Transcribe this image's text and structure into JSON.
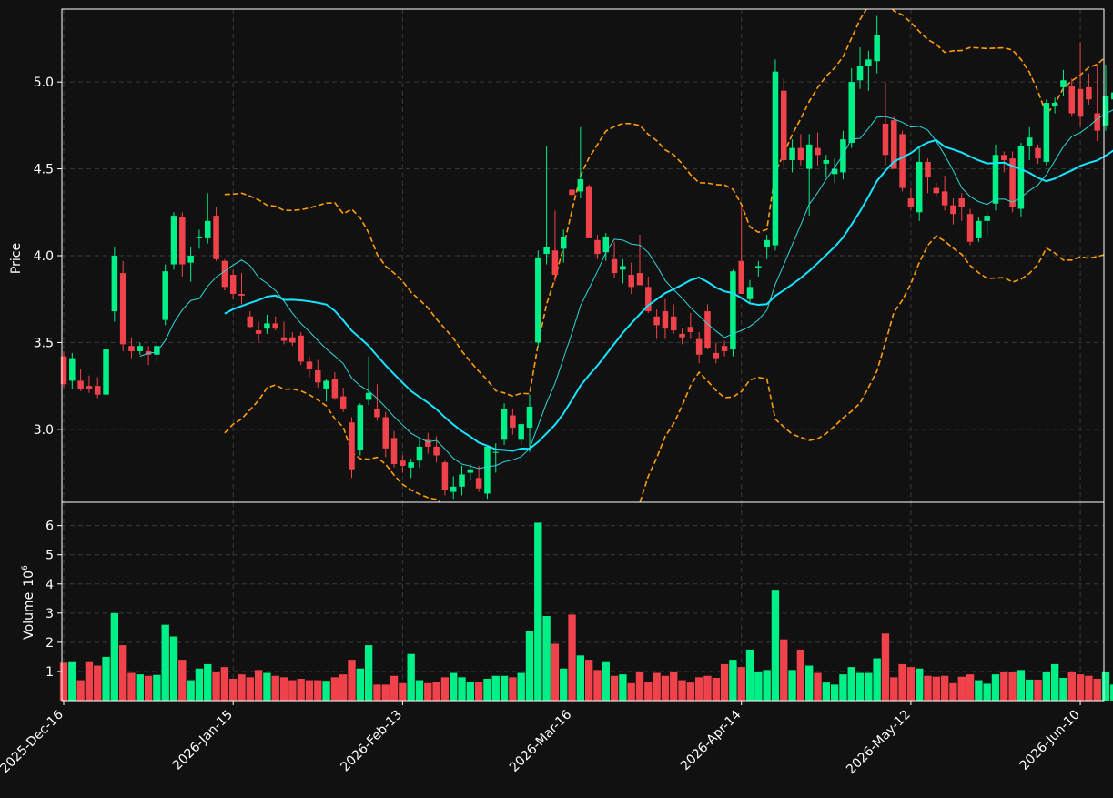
{
  "chart_data": {
    "type": "candlestick",
    "title": "",
    "colors": {
      "background": "#111111",
      "up": "#00f088",
      "down": "#f0424a",
      "ma_fast": "#2fd7d7",
      "ma_slow": "#18e4ff",
      "bands": "#ff9d0a",
      "grid": "#3a3a3a",
      "text": "#ffffff"
    },
    "price_panel": {
      "ylabel": "Price",
      "ylim": [
        2.58,
        5.42
      ],
      "yticks": [
        {
          "value": 3.0,
          "label": "3.0"
        },
        {
          "value": 3.5,
          "label": "3.5"
        },
        {
          "value": 4.0,
          "label": "4.0"
        },
        {
          "value": 4.5,
          "label": "4.5"
        },
        {
          "value": 5.0,
          "label": "5.0"
        }
      ]
    },
    "volume_panel": {
      "ylabel": "Volume",
      "ylabel_exp": "10",
      "ylabel_exp_power": "6",
      "ylim": [
        0,
        6.8
      ],
      "yticks": [
        {
          "value": 1,
          "label": "1"
        },
        {
          "value": 2,
          "label": "2"
        },
        {
          "value": 3,
          "label": "3"
        },
        {
          "value": 4,
          "label": "4"
        },
        {
          "value": 5,
          "label": "5"
        },
        {
          "value": 6,
          "label": "6"
        }
      ]
    },
    "x_axis": {
      "n": 124,
      "ticks": [
        {
          "index": 0,
          "label": "2025-Dec-16"
        },
        {
          "index": 20,
          "label": "2026-Jan-15"
        },
        {
          "index": 40,
          "label": "2026-Feb-13"
        },
        {
          "index": 60,
          "label": "2026-Mar-16"
        },
        {
          "index": 80,
          "label": "2026-Apr-14"
        },
        {
          "index": 100,
          "label": "2026-May-12"
        },
        {
          "index": 120,
          "label": "2026-Jun-10"
        }
      ]
    },
    "ohlc": [
      [
        3.42,
        3.45,
        3.24,
        3.26
      ],
      [
        3.28,
        3.44,
        3.23,
        3.41
      ],
      [
        3.28,
        3.35,
        3.22,
        3.23
      ],
      [
        3.25,
        3.31,
        3.21,
        3.23
      ],
      [
        3.25,
        3.3,
        3.18,
        3.2
      ],
      [
        3.2,
        3.49,
        3.19,
        3.46
      ],
      [
        3.68,
        4.05,
        3.62,
        4.0
      ],
      [
        3.9,
        3.97,
        3.45,
        3.49
      ],
      [
        3.48,
        3.53,
        3.41,
        3.45
      ],
      [
        3.45,
        3.5,
        3.43,
        3.48
      ],
      [
        3.45,
        3.48,
        3.37,
        3.43
      ],
      [
        3.43,
        3.5,
        3.38,
        3.48
      ],
      [
        3.63,
        3.95,
        3.6,
        3.91
      ],
      [
        3.95,
        4.25,
        3.92,
        4.23
      ],
      [
        4.22,
        4.25,
        3.88,
        3.95
      ],
      [
        3.96,
        4.05,
        3.85,
        4.0
      ],
      [
        4.1,
        4.15,
        4.04,
        4.11
      ],
      [
        4.1,
        4.36,
        4.07,
        4.2
      ],
      [
        4.23,
        4.28,
        3.97,
        3.98
      ],
      [
        3.97,
        3.98,
        3.8,
        3.82
      ],
      [
        3.89,
        3.92,
        3.75,
        3.78
      ],
      [
        3.78,
        3.9,
        3.72,
        3.77
      ],
      [
        3.65,
        3.68,
        3.58,
        3.59
      ],
      [
        3.57,
        3.62,
        3.5,
        3.55
      ],
      [
        3.58,
        3.66,
        3.55,
        3.61
      ],
      [
        3.61,
        3.65,
        3.57,
        3.58
      ],
      [
        3.53,
        3.62,
        3.49,
        3.51
      ],
      [
        3.53,
        3.56,
        3.48,
        3.5
      ],
      [
        3.54,
        3.56,
        3.37,
        3.39
      ],
      [
        3.39,
        3.42,
        3.3,
        3.35
      ],
      [
        3.34,
        3.4,
        3.24,
        3.27
      ],
      [
        3.23,
        3.29,
        3.16,
        3.28
      ],
      [
        3.29,
        3.33,
        3.17,
        3.18
      ],
      [
        3.19,
        3.24,
        3.1,
        3.12
      ],
      [
        3.04,
        3.07,
        2.72,
        2.77
      ],
      [
        2.88,
        3.15,
        2.85,
        3.14
      ],
      [
        3.17,
        3.42,
        3.14,
        3.21
      ],
      [
        3.12,
        3.26,
        3.05,
        3.07
      ],
      [
        3.07,
        3.1,
        2.84,
        2.89
      ],
      [
        2.95,
        2.99,
        2.78,
        2.8
      ],
      [
        2.82,
        2.85,
        2.75,
        2.79
      ],
      [
        2.78,
        2.83,
        2.72,
        2.81
      ],
      [
        2.82,
        2.95,
        2.78,
        2.9
      ],
      [
        2.94,
        2.98,
        2.86,
        2.9
      ],
      [
        2.9,
        2.96,
        2.81,
        2.85
      ],
      [
        2.81,
        2.82,
        2.62,
        2.65
      ],
      [
        2.64,
        2.73,
        2.6,
        2.67
      ],
      [
        2.67,
        2.79,
        2.62,
        2.74
      ],
      [
        2.75,
        2.8,
        2.71,
        2.77
      ],
      [
        2.72,
        2.79,
        2.64,
        2.66
      ],
      [
        2.63,
        2.9,
        2.6,
        2.9
      ],
      [
        2.87,
        2.92,
        2.75,
        2.87
      ],
      [
        2.94,
        3.15,
        2.91,
        3.12
      ],
      [
        3.08,
        3.12,
        2.97,
        3.01
      ],
      [
        2.94,
        3.04,
        2.91,
        3.03
      ],
      [
        3.01,
        3.2,
        2.87,
        3.13
      ],
      [
        3.5,
        4.03,
        3.47,
        3.99
      ],
      [
        4.01,
        4.63,
        3.95,
        4.05
      ],
      [
        4.03,
        4.26,
        3.85,
        3.89
      ],
      [
        4.04,
        4.15,
        3.96,
        4.11
      ],
      [
        4.38,
        4.6,
        4.32,
        4.35
      ],
      [
        4.37,
        4.74,
        4.33,
        4.44
      ],
      [
        4.4,
        4.41,
        4.12,
        4.1
      ],
      [
        4.09,
        4.12,
        3.98,
        4.01
      ],
      [
        4.02,
        4.13,
        3.97,
        4.11
      ],
      [
        3.98,
        4.08,
        3.87,
        3.9
      ],
      [
        3.92,
        3.98,
        3.84,
        3.94
      ],
      [
        3.89,
        3.96,
        3.78,
        3.82
      ],
      [
        3.9,
        4.12,
        3.86,
        3.83
      ],
      [
        3.82,
        3.88,
        3.67,
        3.68
      ],
      [
        3.65,
        3.69,
        3.52,
        3.6
      ],
      [
        3.68,
        3.75,
        3.52,
        3.58
      ],
      [
        3.65,
        3.72,
        3.55,
        3.57
      ],
      [
        3.55,
        3.58,
        3.49,
        3.53
      ],
      [
        3.59,
        3.67,
        3.52,
        3.56
      ],
      [
        3.52,
        3.56,
        3.38,
        3.43
      ],
      [
        3.68,
        3.72,
        3.46,
        3.47
      ],
      [
        3.44,
        3.5,
        3.38,
        3.41
      ],
      [
        3.48,
        3.51,
        3.42,
        3.45
      ],
      [
        3.46,
        3.92,
        3.42,
        3.91
      ],
      [
        3.97,
        4.28,
        3.88,
        3.78
      ],
      [
        3.75,
        3.86,
        3.72,
        3.82
      ],
      [
        3.93,
        3.97,
        3.88,
        3.94
      ],
      [
        4.05,
        4.12,
        3.98,
        4.09
      ],
      [
        4.06,
        5.13,
        4.03,
        5.06
      ],
      [
        4.95,
        5.02,
        4.51,
        4.55
      ],
      [
        4.55,
        4.67,
        4.48,
        4.62
      ],
      [
        4.62,
        4.7,
        4.52,
        4.55
      ],
      [
        4.5,
        4.7,
        4.23,
        4.64
      ],
      [
        4.62,
        4.71,
        4.52,
        4.58
      ],
      [
        4.53,
        4.58,
        4.45,
        4.55
      ],
      [
        4.47,
        4.56,
        4.42,
        4.5
      ],
      [
        4.48,
        4.72,
        4.44,
        4.67
      ],
      [
        4.65,
        5.08,
        4.62,
        5.0
      ],
      [
        5.01,
        5.2,
        4.96,
        5.09
      ],
      [
        5.09,
        5.18,
        4.95,
        5.13
      ],
      [
        5.12,
        5.38,
        5.05,
        5.27
      ],
      [
        4.76,
        5.0,
        4.52,
        4.58
      ],
      [
        4.78,
        4.8,
        4.5,
        4.5
      ],
      [
        4.7,
        4.72,
        4.37,
        4.39
      ],
      [
        4.33,
        4.39,
        4.26,
        4.28
      ],
      [
        4.25,
        4.62,
        4.2,
        4.54
      ],
      [
        4.54,
        4.56,
        4.36,
        4.45
      ],
      [
        4.39,
        4.42,
        4.34,
        4.36
      ],
      [
        4.37,
        4.46,
        4.26,
        4.29
      ],
      [
        4.29,
        4.33,
        4.18,
        4.24
      ],
      [
        4.33,
        4.36,
        4.2,
        4.28
      ],
      [
        4.24,
        4.27,
        4.06,
        4.08
      ],
      [
        4.1,
        4.22,
        4.08,
        4.2
      ],
      [
        4.2,
        4.25,
        4.12,
        4.23
      ],
      [
        4.3,
        4.64,
        4.26,
        4.58
      ],
      [
        4.58,
        4.6,
        4.48,
        4.55
      ],
      [
        4.56,
        4.6,
        4.25,
        4.28
      ],
      [
        4.27,
        4.65,
        4.22,
        4.63
      ],
      [
        4.63,
        4.74,
        4.55,
        4.68
      ],
      [
        4.62,
        4.64,
        4.53,
        4.56
      ],
      [
        4.54,
        4.9,
        4.52,
        4.88
      ],
      [
        4.86,
        4.91,
        4.82,
        4.88
      ],
      [
        4.97,
        5.07,
        4.92,
        5.01
      ],
      [
        4.98,
        5.02,
        4.8,
        4.82
      ],
      [
        4.96,
        5.23,
        4.75,
        4.8
      ],
      [
        4.97,
        5.05,
        4.87,
        4.9
      ],
      [
        4.82,
        5.1,
        4.66,
        4.72
      ],
      [
        4.75,
        5.1,
        4.72,
        4.92
      ],
      [
        4.9,
        5.1,
        4.86,
        4.94
      ]
    ],
    "volume": [
      1.3,
      1.35,
      0.7,
      1.35,
      1.2,
      1.5,
      3.0,
      1.9,
      0.95,
      0.9,
      0.85,
      0.88,
      2.6,
      2.2,
      1.4,
      0.7,
      1.1,
      1.25,
      1.0,
      1.15,
      0.75,
      0.9,
      0.8,
      1.05,
      0.95,
      0.85,
      0.8,
      0.7,
      0.75,
      0.7,
      0.7,
      0.68,
      0.8,
      0.9,
      1.4,
      1.1,
      1.9,
      0.55,
      0.55,
      0.85,
      0.6,
      1.6,
      0.7,
      0.6,
      0.65,
      0.8,
      0.95,
      0.8,
      0.65,
      0.65,
      0.75,
      0.85,
      0.85,
      0.8,
      0.95,
      2.4,
      6.1,
      2.9,
      1.95,
      1.1,
      2.95,
      1.55,
      1.4,
      1.05,
      1.35,
      0.85,
      0.9,
      0.6,
      1.0,
      0.65,
      0.95,
      0.85,
      1.0,
      0.7,
      0.62,
      0.8,
      0.85,
      0.78,
      1.25,
      1.4,
      1.15,
      1.75,
      1.0,
      1.05,
      3.8,
      2.1,
      1.05,
      1.75,
      1.2,
      0.95,
      0.62,
      0.55,
      0.9,
      1.15,
      0.95,
      0.95,
      1.45,
      2.3,
      0.8,
      1.25,
      1.15,
      1.1,
      0.85,
      0.82,
      0.85,
      0.6,
      0.82,
      0.9,
      0.7,
      0.58,
      0.9,
      1.0,
      0.98,
      1.05,
      0.72,
      0.72,
      1.0,
      1.25,
      0.78,
      1.0,
      0.9,
      0.85,
      0.75,
      1.0,
      0.55
    ]
  }
}
